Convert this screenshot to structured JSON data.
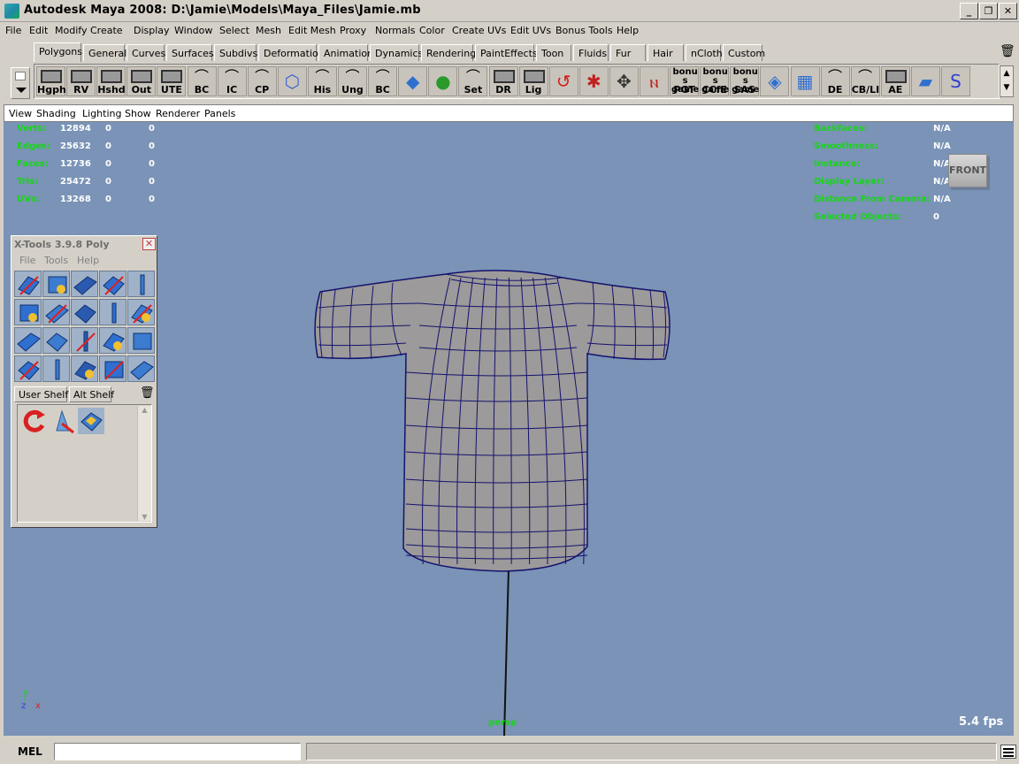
{
  "window": {
    "title": "Autodesk Maya 2008: D:\\Jamie\\Models\\Maya_Files\\Jamie.mb"
  },
  "menubar": [
    "File",
    "Edit",
    "Modify",
    "Create",
    "Display",
    "Window",
    "Select",
    "Mesh",
    "Edit Mesh",
    "Proxy",
    "Normals",
    "Color",
    "Create UVs",
    "Edit UVs",
    "Bonus Tools",
    "Help"
  ],
  "shelf_tabs": [
    "Polygons",
    "General",
    "Curves",
    "Surfaces",
    "Subdivs",
    "Deformation",
    "Animation",
    "Dynamics",
    "Rendering",
    "PaintEffects",
    "Toon",
    "Fluids",
    "Fur",
    "Hair",
    "nCloth",
    "Custom"
  ],
  "shelf_buttons": [
    "Hgph",
    "RV",
    "Hshd",
    "Out",
    "UTE",
    "BC",
    "IC",
    "CP",
    "",
    "His",
    "Ung",
    "BC",
    "",
    "",
    "Set",
    "DR",
    "Lig",
    "",
    "",
    "",
    "",
    "PGT",
    "CCfE",
    "SAS",
    "",
    "",
    "DE",
    "CB/LI",
    "AE",
    "",
    ""
  ],
  "shelf_bonus_top": "bonus game",
  "panel_menu": [
    "View",
    "Shading",
    "Lighting",
    "Show",
    "Renderer",
    "Panels"
  ],
  "hud_left": [
    {
      "label": "Verts:",
      "a": "12894",
      "b": "0",
      "c": "0"
    },
    {
      "label": "Edges:",
      "a": "25632",
      "b": "0",
      "c": "0"
    },
    {
      "label": "Faces:",
      "a": "12736",
      "b": "0",
      "c": "0"
    },
    {
      "label": "Tris:",
      "a": "25472",
      "b": "0",
      "c": "0"
    },
    {
      "label": "UVs:",
      "a": "13268",
      "b": "0",
      "c": "0"
    }
  ],
  "hud_right": [
    {
      "label": "Backfaces:",
      "value": "N/A"
    },
    {
      "label": "Smoothness:",
      "value": "N/A"
    },
    {
      "label": "Instance:",
      "value": "N/A"
    },
    {
      "label": "Display Layer:",
      "value": "N/A"
    },
    {
      "label": "Distance From Camera:",
      "value": "N/A"
    },
    {
      "label": "Selected Objects:",
      "value": "0"
    }
  ],
  "viewcube": "FRONT",
  "camera": "persp",
  "fps": "5.4 fps",
  "axis": {
    "y": "y",
    "z": "z",
    "x": "x"
  },
  "xtools": {
    "title": "X-Tools 3.9.8 Poly",
    "menu": [
      "File",
      "Tools",
      "Help"
    ],
    "tabs": [
      "User Shelf",
      "Alt Shelf"
    ]
  },
  "cmdline": {
    "label": "MEL",
    "value": ""
  },
  "colors": {
    "viewport_bg": "#7a93b6",
    "mesh": "#9c9a9a",
    "wire": "#14126e",
    "hud_green": "#17d617"
  }
}
